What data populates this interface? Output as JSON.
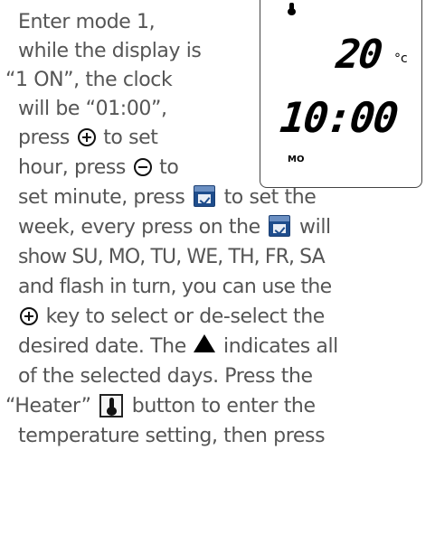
{
  "lines": [
    "Enter mode 1,",
    "while the display is",
    "“1 ON”, the clock",
    "will be “01:00”,",
    "press",
    "to set",
    "hour, press",
    "to",
    "set minute, press",
    "to set the",
    "week, every press on the",
    "will",
    "show SU, MO, TU, WE, TH, FR, SA",
    "and flash in turn, you can use the",
    "key to select or de-select the",
    "desired date. The",
    "indicates all",
    "of the selected days. Press the",
    "“Heater”",
    "button to enter the",
    "temperature setting, then press"
  ],
  "lcd": {
    "temperature": "20",
    "unit": "°c",
    "time": "10:00",
    "day": "MO"
  },
  "icons": {
    "plus": "plus-circle-icon",
    "minus": "minus-circle-icon",
    "calendar": "calendar-check-icon",
    "triangle": "triangle-up-icon",
    "heater": "heater-thermometer-icon"
  }
}
